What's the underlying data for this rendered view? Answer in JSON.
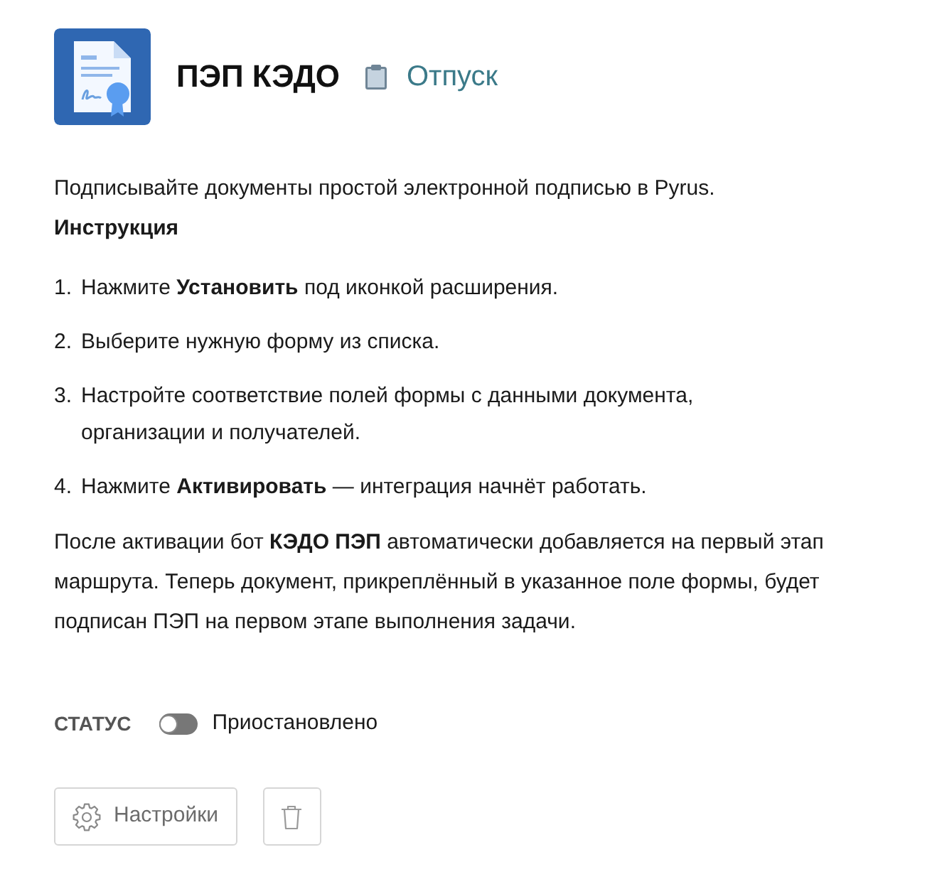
{
  "header": {
    "title": "ПЭП КЭДО",
    "form_name": "Отпуск"
  },
  "description": "Подписывайте документы простой электронной подписью в Pyrus.",
  "instruction_title": "Инструкция",
  "steps": [
    {
      "number": "1.",
      "text": "Нажмите **Установить** под иконкой расширения."
    },
    {
      "number": "2.",
      "text": "Выберите нужную форму из списка."
    },
    {
      "number": "3.",
      "text": "Настройте соответствие полей формы с данными документа, организации и получателей."
    },
    {
      "number": "4.",
      "text": "Нажмите **Активировать** — интеграция начнёт работать."
    }
  ],
  "note": "После активации бот **КЭДО ПЭП** автоматически добавляется на первый этап маршрута. Теперь документ, прикреплённый в указанное поле формы, будет подписан ПЭП на первом этапе выполнения задачи.",
  "status": {
    "label": "СТАТУС",
    "on": false,
    "state_text": "Приостановлено"
  },
  "buttons": [
    {
      "kind": "settings",
      "label": "Настройки"
    },
    {
      "kind": "delete"
    }
  ]
}
